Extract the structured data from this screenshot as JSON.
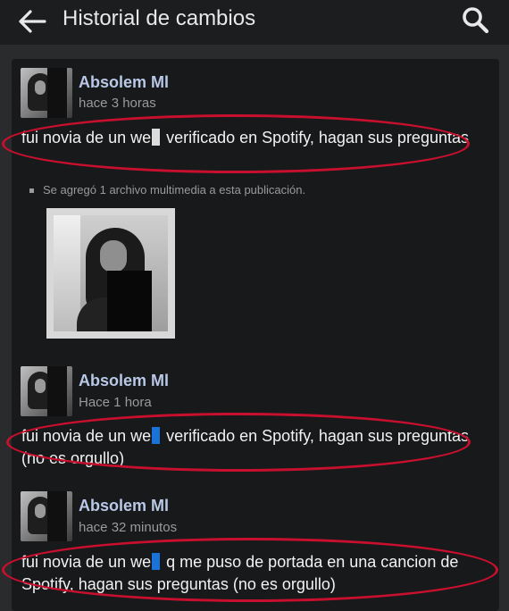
{
  "header": {
    "title": "Historial de cambios",
    "back_icon": "arrow-left-icon",
    "search_icon": "search-icon"
  },
  "entries": [
    {
      "author": "Absolem Ml",
      "time": "hace 3 horas",
      "text_before": "fui novia de un we",
      "text_after": " verificado en Spotify, hagan sus preguntas",
      "media_note": "Se agregó 1 archivo multimedia a esta publicación.",
      "redaction_color": "#dcdcdc"
    },
    {
      "author": "Absolem Ml",
      "time": "Hace 1 hora",
      "text_before": "fui novia de un we",
      "text_after": " verificado en Spotify, hagan sus preguntas (no es orgullo)",
      "redaction_color": "#1a73d9"
    },
    {
      "author": "Absolem Ml",
      "time": "hace 32 minutos",
      "text_before": "fui novia de un we",
      "text_after": " q me puso de portada en una cancion de Spotify, hagan sus preguntas (no es orgullo)",
      "redaction_color": "#1a73d9"
    }
  ],
  "colors": {
    "background": "#2a2b2d",
    "card": "#18191b",
    "author": "#b8c8e6",
    "annotation_oval": "#c8102e"
  }
}
